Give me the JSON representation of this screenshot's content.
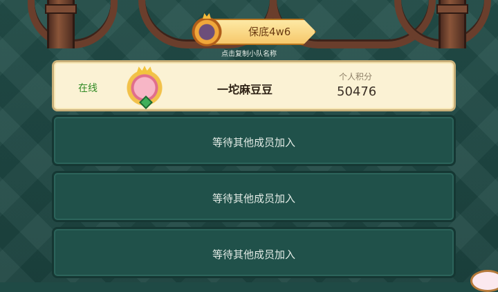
{
  "team": {
    "name": "保底4w6",
    "copy_hint": "点击复制小队名称",
    "emblem_icon": "team-emblem-icon"
  },
  "members": [
    {
      "status": "在线",
      "name": "一坨麻豆豆",
      "score_label": "个人积分",
      "score": "50476",
      "avatar_icon": "crowned-pink-avatar-icon"
    }
  ],
  "empty_slots": [
    {
      "text": "等待其他成员加入"
    },
    {
      "text": "等待其他成员加入"
    },
    {
      "text": "等待其他成员加入"
    }
  ],
  "colors": {
    "background": "#1f4a45",
    "member_card": "#fbf2d4",
    "empty_card": "#20514a",
    "online_green": "#2f8a23",
    "badge_gold": "#f6c86b"
  }
}
